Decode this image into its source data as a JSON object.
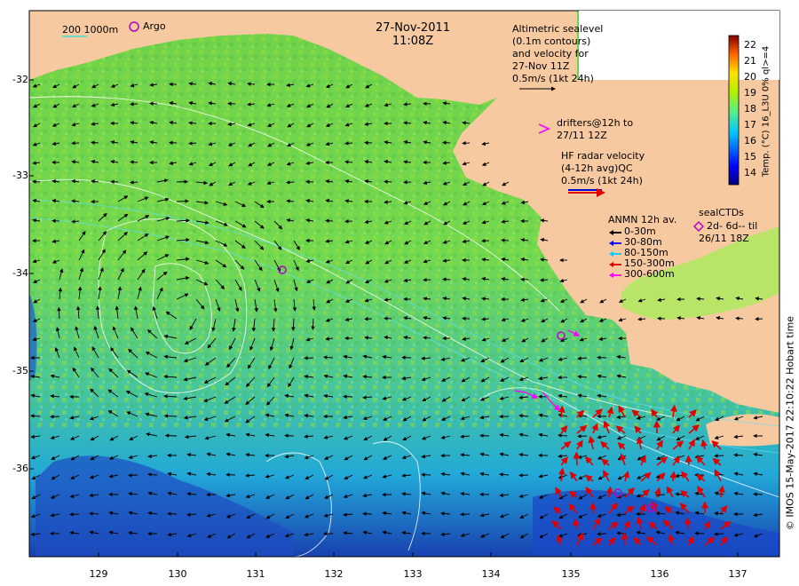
{
  "header": {
    "date": "27-Nov-2011",
    "time": "11:08Z"
  },
  "scale_legend": {
    "depths": "200  1000m",
    "argo": "Argo"
  },
  "altimetry_note": [
    "Altimetric sealevel",
    "(0.1m contours)",
    "and velocity for",
    "27-Nov 11Z",
    "0.5m/s (1kt 24h)"
  ],
  "drifters_note": [
    "drifters@12h to",
    "27/11 12Z"
  ],
  "hf_radar_note": [
    "HF radar velocity",
    "(4-12h avg)QC",
    "0.5m/s (1kt 24h)"
  ],
  "anmn_legend": {
    "title": "ANMN 12h av.",
    "items": [
      {
        "label": "0-30m",
        "color": "#000000"
      },
      {
        "label": "30-80m",
        "color": "#0000ff"
      },
      {
        "label": "80-150m",
        "color": "#00c8ff"
      },
      {
        "label": "150-300m",
        "color": "#e00000"
      },
      {
        "label": "300-600m",
        "color": "#ff00ff"
      }
    ]
  },
  "seal_legend": [
    "sealCTDs",
    "2d- 6d-- til",
    "26/11 18Z"
  ],
  "colorbar": {
    "title": "Temp. (°C) 16_L3U 0% ql>=4",
    "ticks": [
      "22",
      "21",
      "20",
      "19",
      "18",
      "17",
      "16",
      "15",
      "14"
    ]
  },
  "credit": "© IMOS 15-May-2017 22:10:22 Hobart time",
  "axes": {
    "y_ticks": [
      "-32",
      "-33",
      "-34",
      "-35",
      "-36"
    ],
    "x_ticks": [
      "129",
      "130",
      "131",
      "132",
      "133",
      "134",
      "135",
      "136",
      "137"
    ]
  },
  "colors": {
    "land": "#f7c9a0",
    "sst_warm": "#7edc3c",
    "sst_cool": "#1fb3d8",
    "sst_cold": "#1428a0",
    "vector": "#000000",
    "hf_vector": "#e00000",
    "argo": "#c000c0"
  }
}
